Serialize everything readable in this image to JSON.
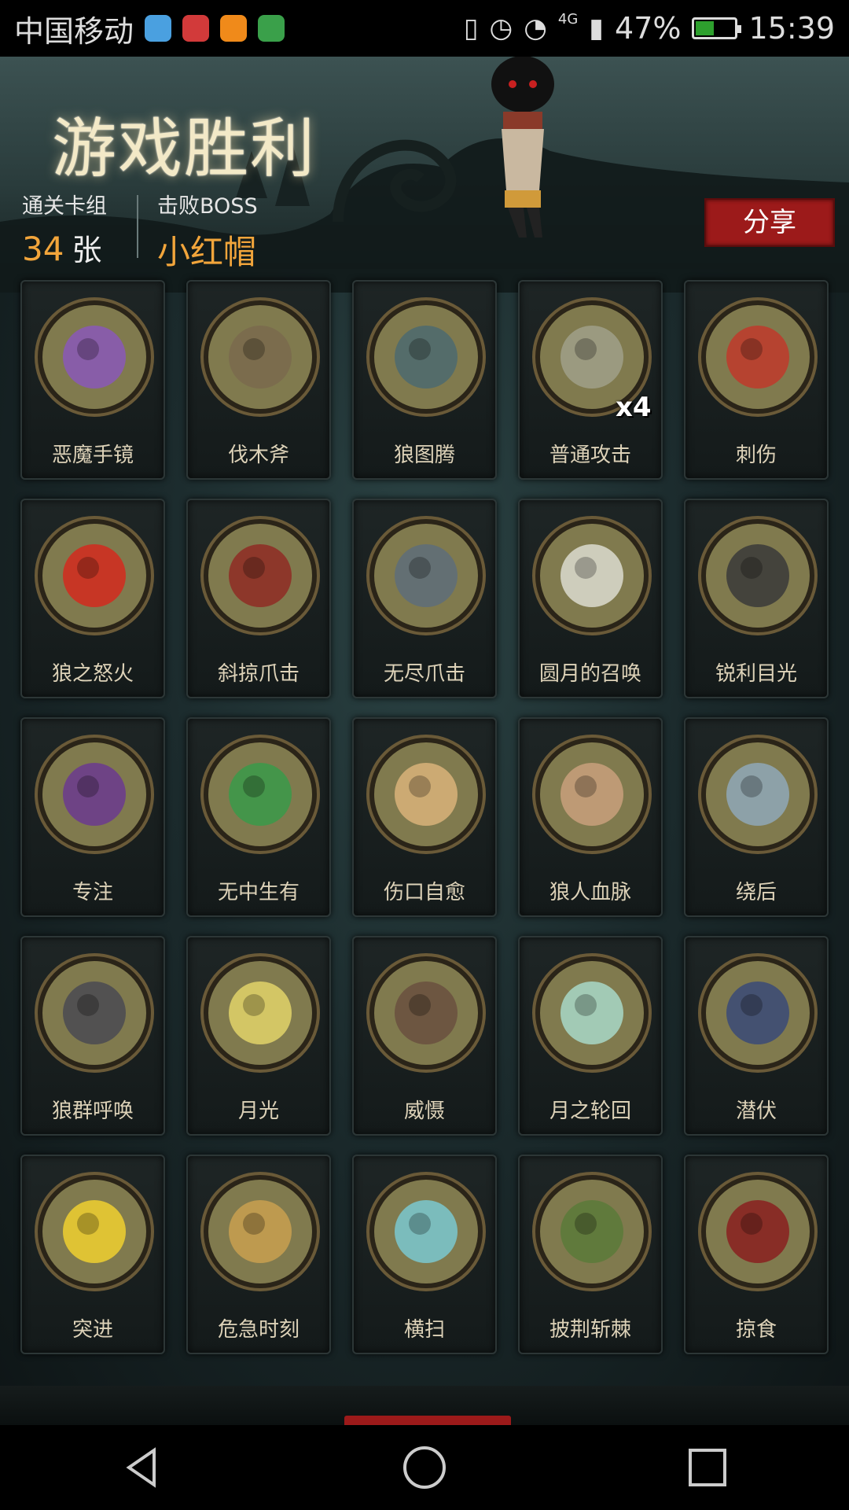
{
  "status_bar": {
    "carrier": "中国移动",
    "network": "4G",
    "battery_percent": "47%",
    "battery_level": 0.47,
    "time": "15:39"
  },
  "header": {
    "title": "游戏胜利",
    "cleared_label": "通关卡组",
    "cleared_value": "34",
    "cleared_unit": "张",
    "boss_label": "击败BOSS",
    "boss_value": "小红帽",
    "share_label": "分享"
  },
  "cards": [
    {
      "label": "恶魔手镜",
      "icon": "mirror-icon",
      "color": "#8a58b8"
    },
    {
      "label": "伐木斧",
      "icon": "axe-icon",
      "color": "#7a6a4e"
    },
    {
      "label": "狼图腾",
      "icon": "wolf-totem-icon",
      "color": "#4c6a70"
    },
    {
      "label": "普通攻击",
      "icon": "axe-slash-icon",
      "color": "#a0a08a",
      "badge": "x4"
    },
    {
      "label": "刺伤",
      "icon": "sword-icon",
      "color": "#c0392b"
    },
    {
      "label": "狼之怒火",
      "icon": "wolf-rage-icon",
      "color": "#d42a1e"
    },
    {
      "label": "斜掠爪击",
      "icon": "claw-icon",
      "color": "#8f2c24"
    },
    {
      "label": "无尽爪击",
      "icon": "endless-claw-icon",
      "color": "#5e6d7a"
    },
    {
      "label": "圆月的召唤",
      "icon": "moon-forest-icon",
      "color": "#dcdcd0"
    },
    {
      "label": "锐利目光",
      "icon": "wolf-eyes-icon",
      "color": "#3a3a3a"
    },
    {
      "label": "专注",
      "icon": "wizard-icon",
      "color": "#6b3a8f"
    },
    {
      "label": "无中生有",
      "icon": "portal-icon",
      "color": "#3a9a4a"
    },
    {
      "label": "伤口自愈",
      "icon": "heal-icon",
      "color": "#d9b37a"
    },
    {
      "label": "狼人血脉",
      "icon": "bloodline-icon",
      "color": "#c9a07c"
    },
    {
      "label": "绕后",
      "icon": "flank-icon",
      "color": "#8fa8b8"
    },
    {
      "label": "狼群呼唤",
      "icon": "pack-call-icon",
      "color": "#4a4a52"
    },
    {
      "label": "月光",
      "icon": "full-moon-icon",
      "color": "#e2d36a"
    },
    {
      "label": "威慑",
      "icon": "deter-icon",
      "color": "#6a5040"
    },
    {
      "label": "月之轮回",
      "icon": "moon-phases-icon",
      "color": "#a8d8c8"
    },
    {
      "label": "潜伏",
      "icon": "lurk-icon",
      "color": "#3a4a78"
    },
    {
      "label": "突进",
      "icon": "dash-icon",
      "color": "#f0d030"
    },
    {
      "label": "危急时刻",
      "icon": "crisis-icon",
      "color": "#c9a050"
    },
    {
      "label": "横扫",
      "icon": "sweep-icon",
      "color": "#7ac8d0"
    },
    {
      "label": "披荆斩棘",
      "icon": "thorn-cut-icon",
      "color": "#5a7a3a"
    },
    {
      "label": "掠食",
      "icon": "predator-icon",
      "color": "#8a2020"
    }
  ]
}
